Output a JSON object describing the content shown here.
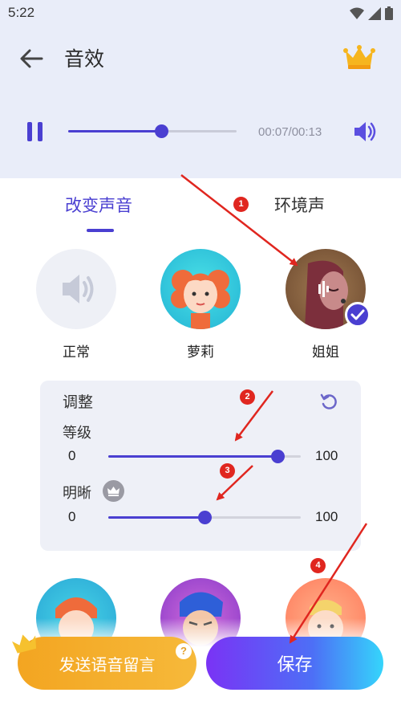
{
  "status_bar": {
    "time": "5:22"
  },
  "header": {
    "title": "音效"
  },
  "player": {
    "time": "00:07/00:13",
    "progress": 0.55
  },
  "tabs": [
    {
      "label": "改变声音",
      "active": true
    },
    {
      "label": "环境声",
      "active": false
    }
  ],
  "voices": [
    {
      "label": "正常",
      "selected": false
    },
    {
      "label": "萝莉",
      "selected": false
    },
    {
      "label": "姐姐",
      "selected": true
    }
  ],
  "adjust": {
    "title": "调整",
    "level": {
      "label": "等级",
      "min": "0",
      "max": "100",
      "value": 88
    },
    "clarity": {
      "label": "明晰",
      "min": "0",
      "max": "100",
      "value": 50,
      "vip": true
    }
  },
  "buttons": {
    "send_voice_message": "发送语音留言",
    "help": "?",
    "save": "保存"
  },
  "annotations": [
    "1",
    "2",
    "3",
    "4"
  ],
  "colors": {
    "accent": "#4a3fd1",
    "header_bg": "#e9edf9",
    "send_button": "#f3a521",
    "arrow": "#e0261f"
  }
}
